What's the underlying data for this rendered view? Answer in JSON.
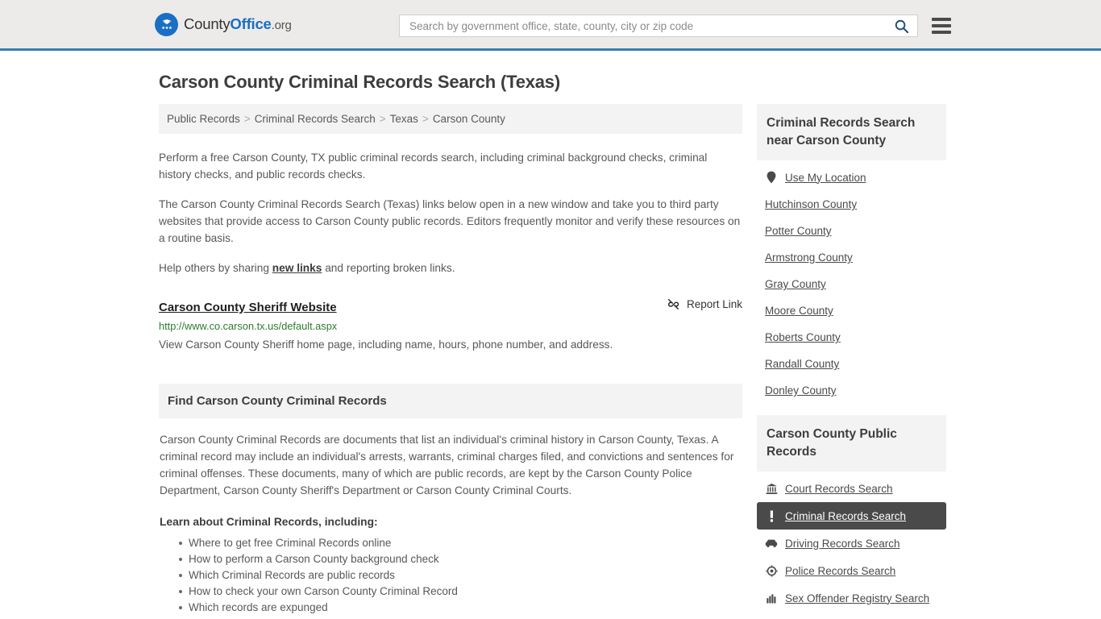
{
  "header": {
    "logo": {
      "icon": "eagle-seal-icon",
      "text_1": "County",
      "text_2": "Office",
      "text_3": ".org"
    },
    "search": {
      "placeholder": "Search by government office, state, county, city or zip code",
      "value": "",
      "search_icon": "search-icon"
    },
    "menu_icon": "hamburger-menu-icon"
  },
  "page": {
    "title": "Carson County Criminal Records Search (Texas)"
  },
  "breadcrumb": {
    "separator": ">",
    "items": [
      {
        "label": "Public Records"
      },
      {
        "label": "Criminal Records Search"
      },
      {
        "label": "Texas"
      },
      {
        "label": "Carson County"
      }
    ]
  },
  "intro": {
    "paragraph_1": "Perform a free Carson County, TX public criminal records search, including criminal background checks, criminal history checks, and public records checks.",
    "paragraph_2": "The Carson County Criminal Records Search (Texas) links below open in a new window and take you to third party websites that provide access to Carson County public records. Editors frequently monitor and verify these resources on a routine basis.",
    "paragraph_3_before": "Help others by sharing ",
    "paragraph_3_link": "new links",
    "paragraph_3_after": " and reporting broken links."
  },
  "result": {
    "title": "Carson County Sheriff Website",
    "report_label": "Report Link",
    "report_icon": "broken-link-icon",
    "url": "http://www.co.carson.tx.us/default.aspx",
    "description": "View Carson County Sheriff home page, including name, hours, phone number, and address."
  },
  "find_section": {
    "heading": "Find Carson County Criminal Records",
    "body": "Carson County Criminal Records are documents that list an individual's criminal history in Carson County, Texas. A criminal record may include an individual's arrests, warrants, criminal charges filed, and convictions and sentences for criminal offenses. These documents, many of which are public records, are kept by the Carson County Police Department, Carson County Sheriff's Department or Carson County Criminal Courts.",
    "learn_title": "Learn about Criminal Records, including:",
    "learn_items": [
      "Where to get free Criminal Records online",
      "How to perform a Carson County background check",
      "Which Criminal Records are public records",
      "How to check your own Carson County Criminal Record",
      "Which records are expunged"
    ]
  },
  "sidebar": {
    "nearby": {
      "heading": "Criminal Records Search near Carson County",
      "items": [
        {
          "label": "Use My Location",
          "icon": "map-pin-icon"
        },
        {
          "label": "Hutchinson County",
          "icon": ""
        },
        {
          "label": "Potter County",
          "icon": ""
        },
        {
          "label": "Armstrong County",
          "icon": ""
        },
        {
          "label": "Gray County",
          "icon": ""
        },
        {
          "label": "Moore County",
          "icon": ""
        },
        {
          "label": "Roberts County",
          "icon": ""
        },
        {
          "label": "Randall County",
          "icon": ""
        },
        {
          "label": "Donley County",
          "icon": ""
        }
      ]
    },
    "public_records": {
      "heading": "Carson County Public Records",
      "items": [
        {
          "label": "Court Records Search",
          "icon": "courthouse-icon",
          "active": false
        },
        {
          "label": "Criminal Records Search",
          "icon": "exclamation-icon",
          "active": true
        },
        {
          "label": "Driving Records Search",
          "icon": "car-icon",
          "active": false
        },
        {
          "label": "Police Records Search",
          "icon": "police-badge-icon",
          "active": false
        },
        {
          "label": "Sex Offender Registry Search",
          "icon": "fingerprint-icon",
          "active": false
        }
      ]
    }
  },
  "colors": {
    "brand_blue": "#1a6fc4",
    "header_border": "#3b7cb3",
    "url_green": "#2f7a2f",
    "active_bg": "#4a4a4a",
    "panel_gray": "#f3f3f3"
  }
}
